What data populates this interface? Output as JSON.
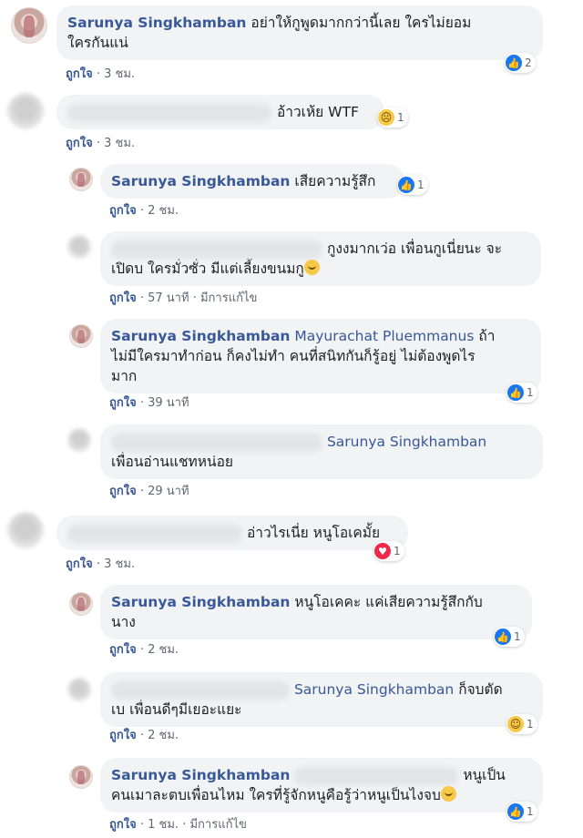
{
  "reply_label": "ถูกใจ",
  "comments": [
    {
      "author": "Sarunya Singkhamban",
      "lines": [
        "อย่าให้กูพูดมากกว่านี้เลย ใครไม่ยอม",
        "ใครกันแน่"
      ],
      "time": "3 ชม.",
      "reaction": {
        "icon": "like-icon",
        "count": "2"
      }
    },
    {
      "author": "",
      "lines": [
        "อ้าวเห้ย WTF"
      ],
      "time": "3 ชม.",
      "reaction": {
        "icon": "sad-icon",
        "count": "1"
      }
    },
    {
      "author": "Sarunya Singkhamban",
      "lines": [
        "เสียความรู้สึก"
      ],
      "time": "2 ชม.",
      "reaction": {
        "icon": "like-icon",
        "count": "1"
      }
    },
    {
      "author": "",
      "lines": [
        "กูงงมากเว่อ เพื่อนกูเนี่ยนะ จะ",
        "เปิดบ ใครมั่วซั่ว มีแต่เลี้ยงขนมกู"
      ],
      "time": "57 นาที",
      "edited": "มีการแก้ไข"
    },
    {
      "author": "Sarunya Singkhamban",
      "tag": "Mayurachat Pluemmanus",
      "lines": [
        "ถ้า",
        "ไม่มีใครมาทำก่อน ก็คงไม่ทำ คนที่สนิทกันก็รู้อยู่ ไม่ต้องพูดไร",
        "มาก"
      ],
      "time": "39 นาที",
      "reaction": {
        "icon": "like-icon",
        "count": "1"
      }
    },
    {
      "author": "",
      "tag": "Sarunya Singkhamban",
      "lines": [
        "เพื่อนอ่านแชทหน่อย"
      ],
      "time": "29 นาที"
    },
    {
      "author": "",
      "lines": [
        "อ่าวไรเนี่ย หนูโอเคมั้ย"
      ],
      "time": "3 ชม.",
      "reaction": {
        "icon": "heart-icon",
        "count": "1"
      }
    },
    {
      "author": "Sarunya Singkhamban",
      "lines": [
        "หนูโอเคคะ แค่เสียความรู้สึกกับ",
        "นาง"
      ],
      "time": "2 ชม.",
      "reaction": {
        "icon": "like-icon",
        "count": "1"
      }
    },
    {
      "author": "",
      "tag": "Sarunya Singkhamban",
      "lines": [
        "ก็จบตัด",
        "เบ เพื่อนดีๆมีเยอะแยะ"
      ],
      "time": "2 ชม.",
      "reaction": {
        "icon": "haha-icon",
        "count": "1"
      }
    },
    {
      "author": "Sarunya Singkhamban",
      "lines": [
        "หนูเป็น",
        "คนเมาละตบเพื่อนไหม ใครที่รู้จักหนูคือรู้ว่าหนูเป็นไงจบ"
      ],
      "time": "1 ชม.",
      "edited": "มีการแก้ไข",
      "reaction": {
        "icon": "like-icon",
        "count": "1"
      }
    }
  ]
}
